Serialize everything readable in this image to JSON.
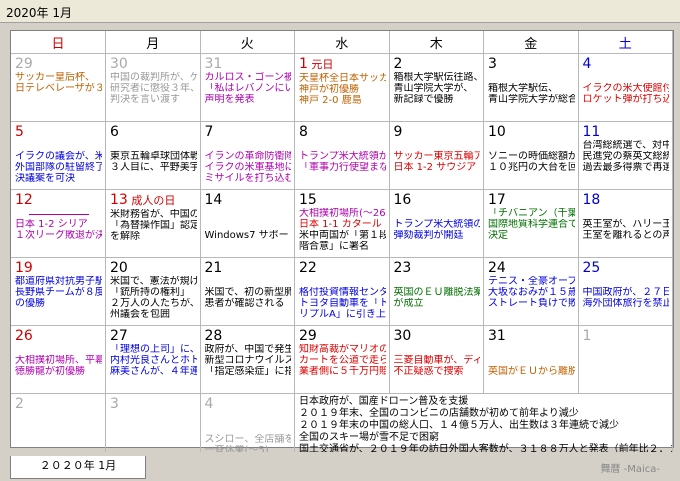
{
  "title": "2020年 1月",
  "weekdays": [
    "日",
    "月",
    "火",
    "水",
    "木",
    "金",
    "土"
  ],
  "weeks": [
    [
      {
        "day": "29",
        "other": true,
        "events": [
          {
            "t": "サッカー皇后杯、",
            "c": "c-orange"
          },
          {
            "t": "日テレベレーザが３",
            "c": "c-orange"
          }
        ]
      },
      {
        "day": "30",
        "other": true,
        "events": [
          {
            "t": "中国の裁判所が、ゲ",
            "c": "c-gray"
          },
          {
            "t": "研究者に懲役３年、",
            "c": "c-gray"
          },
          {
            "t": "判決を言い渡す",
            "c": "c-gray"
          }
        ]
      },
      {
        "day": "31",
        "other": true,
        "events": [
          {
            "t": "カルロス・ゴーン被",
            "c": "c-purple"
          },
          {
            "t": "「私はレバノンにい",
            "c": "c-purple"
          },
          {
            "t": "声明を発表",
            "c": "c-purple"
          }
        ]
      },
      {
        "day": "1",
        "hol": "元日",
        "events": [
          {
            "t": "天皇杯全日本サッカ",
            "c": "c-orange"
          },
          {
            "t": "神戸が初優勝",
            "c": "c-orange"
          },
          {
            "t": "神戸 2-0 鹿島",
            "c": "c-orange"
          }
        ]
      },
      {
        "day": "2",
        "events": [
          {
            "t": "箱根大学駅伝往路、",
            "c": "c-black"
          },
          {
            "t": "青山学院大学が、",
            "c": "c-black"
          },
          {
            "t": "新記録で優勝",
            "c": "c-black"
          }
        ]
      },
      {
        "day": "3",
        "events": [
          {
            "t": "",
            "c": "c-black"
          },
          {
            "t": "箱根大学駅伝、",
            "c": "c-black"
          },
          {
            "t": "青山学院大学が総合",
            "c": "c-black"
          }
        ]
      },
      {
        "day": "4",
        "events": [
          {
            "t": "",
            "c": "c-black"
          },
          {
            "t": "イラクの米大使館付",
            "c": "c-red"
          },
          {
            "t": "ロケット弾が打ち込",
            "c": "c-red"
          }
        ]
      }
    ],
    [
      {
        "day": "5",
        "events": [
          {
            "t": "",
            "c": "c-black"
          },
          {
            "t": "イラクの議会が、米",
            "c": "c-blue"
          },
          {
            "t": "外国部隊の駐留終了",
            "c": "c-blue"
          },
          {
            "t": "決議案を可決",
            "c": "c-blue"
          }
        ]
      },
      {
        "day": "6",
        "events": [
          {
            "t": "",
            "c": "c-black"
          },
          {
            "t": "東京五輪卓球団体戦",
            "c": "c-black"
          },
          {
            "t": "３人目に、平野美宇",
            "c": "c-black"
          }
        ]
      },
      {
        "day": "7",
        "events": [
          {
            "t": "",
            "c": "c-black"
          },
          {
            "t": "イランの革命防衛隊",
            "c": "c-purple"
          },
          {
            "t": "イラクの米軍基地に",
            "c": "c-purple"
          },
          {
            "t": "ミサイルを打ち込む",
            "c": "c-purple"
          }
        ]
      },
      {
        "day": "8",
        "events": [
          {
            "t": "",
            "c": "c-black"
          },
          {
            "t": "トランプ米大統領が",
            "c": "c-purple"
          },
          {
            "t": "「軍事力行使望まな",
            "c": "c-purple"
          }
        ]
      },
      {
        "day": "9",
        "events": [
          {
            "t": "",
            "c": "c-black"
          },
          {
            "t": "サッカー東京五輪ア",
            "c": "c-red"
          },
          {
            "t": "日本 1-2 サウジア",
            "c": "c-red"
          }
        ]
      },
      {
        "day": "10",
        "events": [
          {
            "t": "",
            "c": "c-black"
          },
          {
            "t": "ソニーの時価総額が",
            "c": "c-black"
          },
          {
            "t": "１０兆円の大台を回",
            "c": "c-black"
          }
        ]
      },
      {
        "day": "11",
        "events": [
          {
            "t": "台湾総統選で、対中",
            "c": "c-black"
          },
          {
            "t": "民進党の蔡英文総統",
            "c": "c-black"
          },
          {
            "t": "過去最多得票で再選",
            "c": "c-black"
          }
        ]
      }
    ],
    [
      {
        "day": "12",
        "line": true,
        "events": [
          {
            "t": "",
            "c": "c-black"
          },
          {
            "t": "日本 1-2 シリア",
            "c": "c-purple"
          },
          {
            "t": "１次リーグ敗退が決",
            "c": "c-purple"
          }
        ]
      },
      {
        "day": "13",
        "hol": "成人の日",
        "events": [
          {
            "t": "米財務省が、中国の",
            "c": "c-black"
          },
          {
            "t": "「為替操作国」認定",
            "c": "c-black"
          },
          {
            "t": "を解除",
            "c": "c-black"
          }
        ]
      },
      {
        "day": "14",
        "events": [
          {
            "t": "",
            "c": "c-black"
          },
          {
            "t": "",
            "c": "c-black"
          },
          {
            "t": "Windows7 サポート終",
            "c": "c-black"
          }
        ]
      },
      {
        "day": "15",
        "events": [
          {
            "t": "大相撲初場所(～26)",
            "c": "c-purple"
          },
          {
            "t": "日本 1-1 カタール",
            "c": "c-red"
          },
          {
            "t": "米中両国が「第１段",
            "c": "c-black"
          },
          {
            "t": "階合意」に署名",
            "c": "c-black"
          }
        ]
      },
      {
        "day": "16",
        "events": [
          {
            "t": "",
            "c": "c-black"
          },
          {
            "t": "トランプ米大統領の",
            "c": "c-blue"
          },
          {
            "t": "弾劾裁判が開廷",
            "c": "c-blue"
          }
        ]
      },
      {
        "day": "17",
        "events": [
          {
            "t": "「チバニアン（千葉",
            "c": "c-green"
          },
          {
            "t": "国際地質科学連合で",
            "c": "c-green"
          },
          {
            "t": "決定",
            "c": "c-green"
          }
        ]
      },
      {
        "day": "18",
        "events": [
          {
            "t": "",
            "c": "c-black"
          },
          {
            "t": "英王室が、ハリー王",
            "c": "c-black"
          },
          {
            "t": "王室を離れるとの声",
            "c": "c-black"
          }
        ]
      }
    ],
    [
      {
        "day": "19",
        "events": [
          {
            "t": "都道府県対抗男子駅",
            "c": "c-blue"
          },
          {
            "t": "長野県チームが８度",
            "c": "c-blue"
          },
          {
            "t": "の優勝",
            "c": "c-blue"
          }
        ]
      },
      {
        "day": "20",
        "events": [
          {
            "t": "米国で、憲法が規げ",
            "c": "c-black"
          },
          {
            "t": "「銃所持の権利」",
            "c": "c-black"
          },
          {
            "t": "２万人の人たちが、",
            "c": "c-black"
          },
          {
            "t": "州議会を包囲",
            "c": "c-black"
          }
        ]
      },
      {
        "day": "21",
        "events": [
          {
            "t": "",
            "c": "c-black"
          },
          {
            "t": "米国で、初の新型肺",
            "c": "c-black"
          },
          {
            "t": "患者が確認される",
            "c": "c-black"
          }
        ]
      },
      {
        "day": "22",
        "events": [
          {
            "t": "",
            "c": "c-black"
          },
          {
            "t": "格付投資情報センタ",
            "c": "c-blue"
          },
          {
            "t": "トヨタ自動車を「ト",
            "c": "c-blue"
          },
          {
            "t": "リプルA」に引き上",
            "c": "c-blue"
          }
        ]
      },
      {
        "day": "23",
        "events": [
          {
            "t": "",
            "c": "c-black"
          },
          {
            "t": "英国のＥＵ離脱法案",
            "c": "c-green"
          },
          {
            "t": "が成立",
            "c": "c-green"
          }
        ]
      },
      {
        "day": "24",
        "events": [
          {
            "t": "テニス・全豪オープ",
            "c": "c-blue"
          },
          {
            "t": "大坂なおみが１５歳",
            "c": "c-blue"
          },
          {
            "t": "ストレート負けで敗",
            "c": "c-blue"
          }
        ]
      },
      {
        "day": "25",
        "events": [
          {
            "t": "",
            "c": "c-black"
          },
          {
            "t": "中国政府が、２７日",
            "c": "c-blue"
          },
          {
            "t": "海外団体旅行を禁止",
            "c": "c-blue"
          }
        ]
      }
    ],
    [
      {
        "day": "26",
        "events": [
          {
            "t": "",
            "c": "c-black"
          },
          {
            "t": "大相撲初場所、平幕",
            "c": "c-purple"
          },
          {
            "t": "徳勝龍が初優勝",
            "c": "c-purple"
          }
        ]
      },
      {
        "day": "27",
        "events": [
          {
            "t": "「理想の上司」に、",
            "c": "c-blue"
          },
          {
            "t": "内村光良さんとホト",
            "c": "c-blue"
          },
          {
            "t": "麻美さんが、４年連",
            "c": "c-blue"
          }
        ]
      },
      {
        "day": "28",
        "events": [
          {
            "t": "政府が、中国で発生",
            "c": "c-black"
          },
          {
            "t": "新型コロナウイルス",
            "c": "c-black"
          },
          {
            "t": "「指定感染症」に指",
            "c": "c-black"
          }
        ]
      },
      {
        "day": "29",
        "events": [
          {
            "t": "知財高裁がマリオの",
            "c": "c-red"
          },
          {
            "t": "カートを公道で走ら",
            "c": "c-red"
          },
          {
            "t": "業者側に５千万円賠",
            "c": "c-red"
          }
        ]
      },
      {
        "day": "30",
        "events": [
          {
            "t": "",
            "c": "c-black"
          },
          {
            "t": "三菱自動車が、ディ",
            "c": "c-red"
          },
          {
            "t": "不正疑惑で捜索",
            "c": "c-red"
          }
        ]
      },
      {
        "day": "31",
        "events": [
          {
            "t": "",
            "c": "c-black"
          },
          {
            "t": "",
            "c": "c-black"
          },
          {
            "t": "英国がＥＵから離脱",
            "c": "c-orange"
          }
        ]
      },
      {
        "day": "1",
        "other": true,
        "events": []
      }
    ],
    [
      {
        "day": "2",
        "other": true,
        "events": []
      },
      {
        "day": "3",
        "other": true,
        "events": []
      },
      {
        "day": "4",
        "other": true,
        "events": [
          {
            "t": "",
            "c": "c-black"
          },
          {
            "t": "",
            "c": "c-black"
          },
          {
            "t": "スシロー、全店舗を",
            "c": "c-gray"
          },
          {
            "t": "一斉休業(～5)",
            "c": "c-gray"
          }
        ]
      },
      {
        "day": "notes",
        "events": []
      }
    ]
  ],
  "notes": [
    "日本政府が、国産ドローン普及を支援",
    "２０１９年末、全国のコンビニの店舗数が初めて前年より減少",
    "２０１９年末の中国の総人口、１４億５万人、出生数は３年連続で減少",
    "全国のスキー場が雪不足で困窮",
    "国土交通省が、２０１９年の訪日外国人客数が、３１８８万人と発表（前年比２．２%"
  ],
  "bottom": {
    "tab": "２０２０年 1月",
    "brand": "舞暦 -Maica-"
  }
}
